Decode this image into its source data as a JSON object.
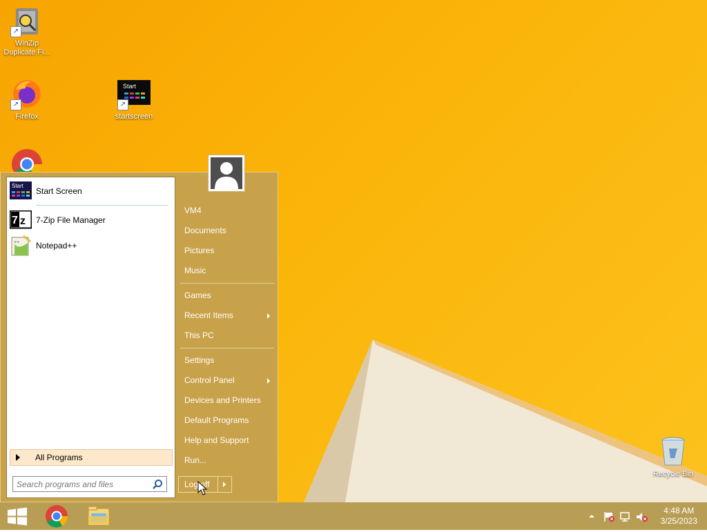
{
  "desktop": {
    "icons": [
      {
        "label": "WinZip Duplicate Fi...",
        "icon": "winzip-duplicate-finder-icon"
      },
      {
        "label": "Firefox",
        "icon": "firefox-icon"
      },
      {
        "label": "startscreen",
        "icon": "startscreen-icon",
        "thumb_text": "Start"
      },
      {
        "label": "",
        "icon": "chrome-icon"
      },
      {
        "label": "Recycle Bin",
        "icon": "recycle-bin-icon"
      }
    ]
  },
  "start_menu": {
    "pinned": [
      {
        "label": "Start Screen",
        "icon": "start-screen-icon",
        "thumb_text": "Start"
      },
      {
        "label": "7-Zip File Manager",
        "icon": "7zip-icon",
        "thumb_text": "7z"
      },
      {
        "label": "Notepad++",
        "icon": "notepad-plus-plus-icon"
      }
    ],
    "all_programs": "All Programs",
    "search_placeholder": "Search programs and files",
    "right_items": [
      {
        "label": "VM4",
        "submenu": false
      },
      {
        "label": "Documents",
        "submenu": false
      },
      {
        "label": "Pictures",
        "submenu": false
      },
      {
        "label": "Music",
        "submenu": false
      },
      {
        "label": "Games",
        "submenu": false
      },
      {
        "label": "Recent Items",
        "submenu": true
      },
      {
        "label": "This PC",
        "submenu": false
      },
      {
        "label": "Settings",
        "submenu": false
      },
      {
        "label": "Control Panel",
        "submenu": true
      },
      {
        "label": "Devices and Printers",
        "submenu": false
      },
      {
        "label": "Default Programs",
        "submenu": false
      },
      {
        "label": "Help and Support",
        "submenu": false
      },
      {
        "label": "Run...",
        "submenu": false
      }
    ],
    "logoff_label": "Log off"
  },
  "taskbar": {
    "buttons": [
      "windows-start-icon",
      "chrome-icon",
      "file-explorer-icon"
    ],
    "clock_time": "4:48 AM",
    "clock_date": "3/25/2023"
  },
  "colors": {
    "desktop_bg": "#fbb50a",
    "start_menu_bg": "#c8a24a",
    "taskbar_bg": "#b89e55"
  }
}
